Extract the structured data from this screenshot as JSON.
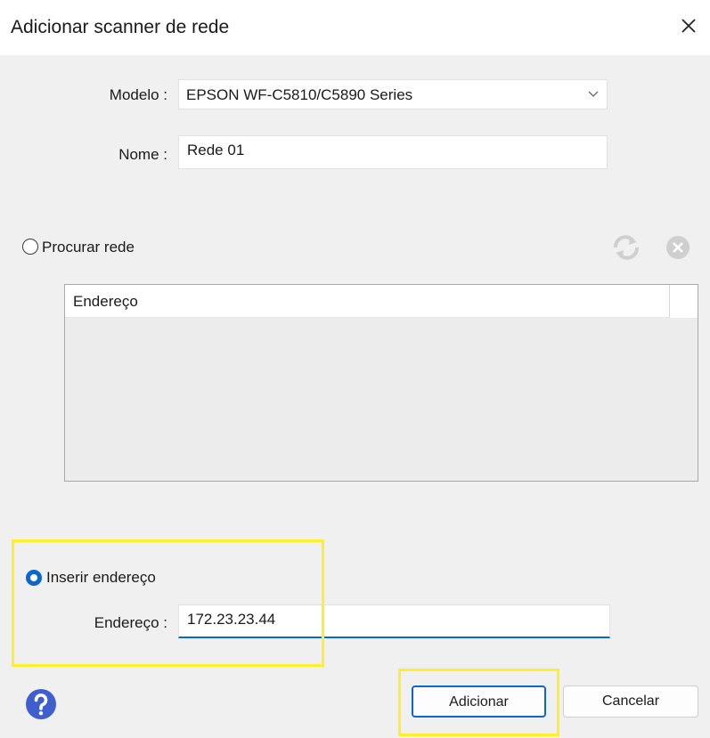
{
  "window": {
    "title": "Adicionar scanner de rede"
  },
  "form": {
    "model_label": "Modelo :",
    "model_value": "EPSON WF-C5810/C5890 Series",
    "name_label": "Nome :",
    "name_value": "Rede 01"
  },
  "search": {
    "option_label": "Procurar rede",
    "selected": false,
    "list_header": "Endereço"
  },
  "manual": {
    "option_label": "Inserir endereço",
    "selected": true,
    "address_label": "Endereço :",
    "address_value": "172.23.23.44"
  },
  "buttons": {
    "add": "Adicionar",
    "cancel": "Cancelar"
  },
  "colors": {
    "accent": "#0b66d0",
    "highlight": "#ffee2a",
    "help": "#3f5fcf"
  },
  "icons": [
    "close-icon",
    "chevron-down-icon",
    "refresh-icon",
    "cancel-search-icon",
    "help-icon"
  ]
}
